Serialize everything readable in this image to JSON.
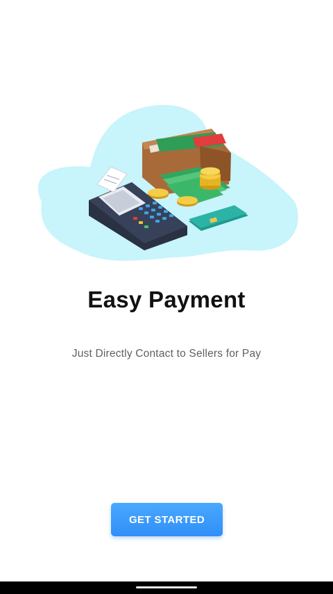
{
  "onboarding": {
    "title": "Easy Payment",
    "subtitle": "Just Directly Contact to Sellers for Pay",
    "cta_label": "GET STARTED"
  },
  "illustration": {
    "icons": [
      "wallet-icon",
      "card-terminal-icon",
      "receipt-icon",
      "banknote-icon",
      "coin-icon",
      "credit-card-icon"
    ]
  },
  "colors": {
    "blob": "#c8f4fb",
    "button": "#3a9bfb",
    "button_text": "#ffffff",
    "title": "#111111",
    "subtitle": "#5f5f5f"
  }
}
